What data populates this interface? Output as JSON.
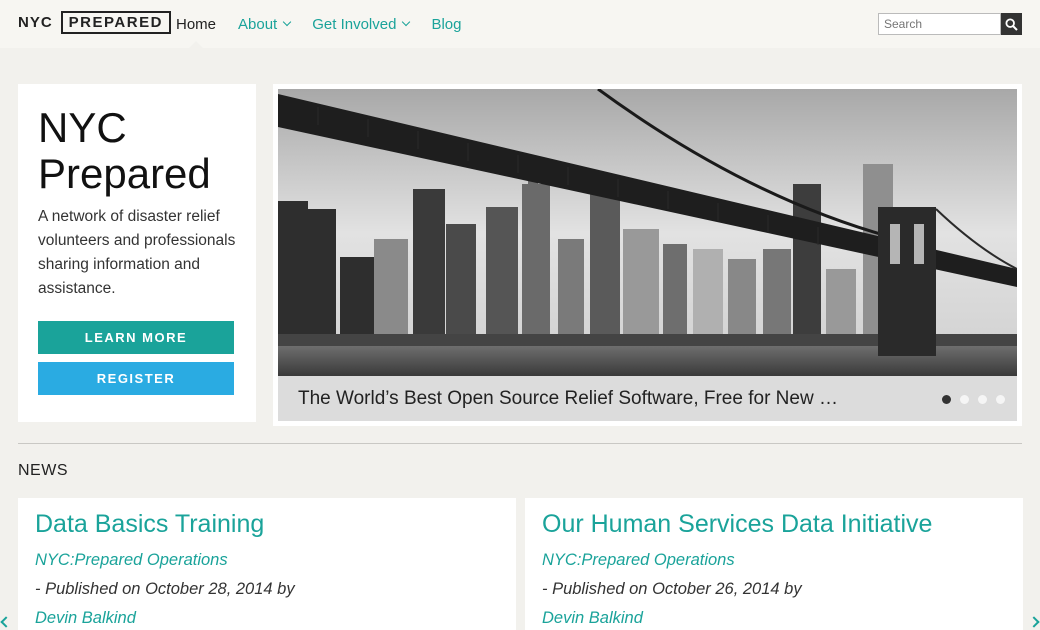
{
  "header": {
    "logo_nyc": "NYC",
    "logo_box": "PREPARED",
    "nav": [
      {
        "label": "Home"
      },
      {
        "label": "About"
      },
      {
        "label": "Get Involved"
      },
      {
        "label": "Blog"
      }
    ],
    "search_placeholder": "Search"
  },
  "intro": {
    "title_line1": "NYC",
    "title_line2": "Prepared",
    "text": "A network of disaster relief volunteers and professionals sharing information and assistance.",
    "learn_more": "LEARN MORE",
    "register": "REGISTER"
  },
  "slider": {
    "caption": "The World’s Best Open Source Relief Software, Free for New …",
    "slide_count": 4,
    "active_slide": 1
  },
  "news": {
    "heading": "NEWS",
    "items": [
      {
        "title": "Data Basics Training",
        "category": "NYC:Prepared Operations",
        "meta": "- Published on October 28, 2014 by",
        "author": "Devin Balkind"
      },
      {
        "title": "Our Human Services Data Initiative",
        "category": "NYC:Prepared Operations",
        "meta": "- Published on October 26, 2014 by",
        "author": "Devin Balkind"
      }
    ]
  },
  "colors": {
    "accent_teal": "#1aa39a",
    "accent_blue": "#2aabe2",
    "background": "#f2f1ed"
  }
}
